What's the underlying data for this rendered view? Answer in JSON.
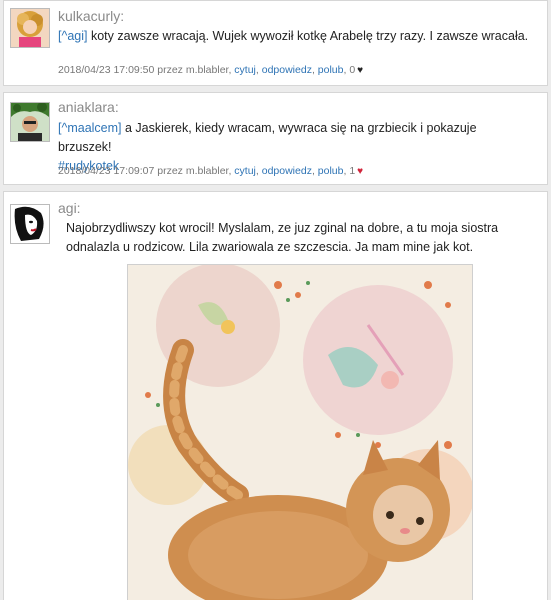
{
  "posts": [
    {
      "username": "kulkacurly:",
      "mention": "[^agi]",
      "text": " koty zawsze wracają. Wujek wywoził kotkę Arabelę trzy razy. I zawsze wracała.",
      "meta": {
        "timestamp": "2018/04/23 17:09:50 przez m.blabler,",
        "quote": "cytuj",
        "reply": "odpowiedz",
        "like": "polub",
        "like_count": "0"
      },
      "liked": false
    },
    {
      "username": "aniaklara:",
      "mention": "[^maalcem]",
      "text": " a Jaskierek, kiedy wracam, wywraca się na grzbiecik i pokazuje brzuszek!",
      "hashtag": "#rudykotek",
      "meta": {
        "timestamp": "2018/04/23 17:09:07 przez m.blabler,",
        "quote": "cytuj",
        "reply": "odpowiedz",
        "like": "polub",
        "like_count": "1"
      },
      "liked": true
    },
    {
      "username": "agi:",
      "text": "Najobrzydliwszy kot wrocil! Myslalam, ze juz zginal na dobre, a tu moja siostra odnalazla u rodzicow. Lila zwariowala ze szczescia. Ja mam mine jak kot."
    }
  ],
  "icons": {
    "liked_heart": "heart-filled-icon",
    "unliked_heart": "heart-outline-icon"
  },
  "colors": {
    "link": "#2f74b5",
    "heart_liked": "#d0243a",
    "username": "#8a8a8a"
  }
}
